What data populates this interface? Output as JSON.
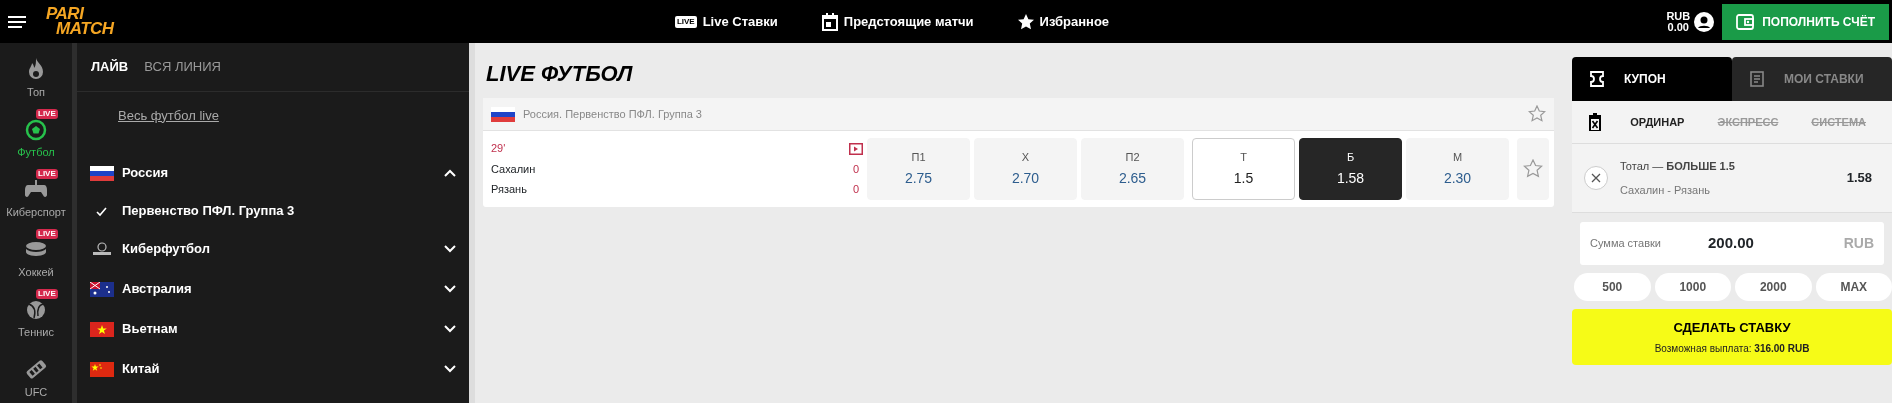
{
  "header": {
    "logo": [
      "PARI",
      "MATCH"
    ],
    "nav": [
      {
        "kind": "live",
        "icon_text": "LIVE",
        "label": "Live Ставки"
      },
      {
        "kind": "calendar",
        "label": "Предстоящие матчи"
      },
      {
        "kind": "star",
        "label": "Избранное"
      }
    ],
    "balance": {
      "currency": "RUB",
      "amount": "0.00"
    },
    "deposit_button": "ПОПОЛНИТЬ СЧЁТ"
  },
  "sports_rail": [
    {
      "kind": "fire",
      "label": "Топ",
      "selected": false
    },
    {
      "kind": "ball",
      "label": "Футбол",
      "badge": "LIVE",
      "selected": true
    },
    {
      "kind": "gamepad",
      "label": "Киберспорт",
      "badge": "LIVE",
      "selected": false
    },
    {
      "kind": "puck",
      "label": "Хоккей",
      "badge": "LIVE",
      "selected": false
    },
    {
      "kind": "tennis",
      "label": "Теннис",
      "badge": "LIVE",
      "selected": false
    },
    {
      "kind": "ufc",
      "label": "UFC",
      "selected": false
    }
  ],
  "tree": {
    "tabs": [
      {
        "label": "ЛАЙВ",
        "selected": true
      },
      {
        "label": "ВСЯ ЛИНИЯ",
        "selected": false
      }
    ],
    "all_link": "Весь футбол live",
    "countries": [
      {
        "kind": "ru",
        "label": "Россия",
        "expanded": true,
        "children": [
          {
            "label": "Первенство ПФЛ. Группа 3",
            "checked": true
          }
        ]
      },
      {
        "kind": "fifa",
        "label": "Киберфутбол",
        "expanded": false
      },
      {
        "kind": "au",
        "label": "Австралия",
        "expanded": false
      },
      {
        "kind": "vn",
        "label": "Вьетнам",
        "expanded": false
      },
      {
        "kind": "cn",
        "label": "Китай",
        "expanded": false
      }
    ]
  },
  "main": {
    "title": "LIVE ФУТБОЛ",
    "league": {
      "kind": "ru",
      "name": "Россия. Первенство ПФЛ. Группа 3"
    },
    "match": {
      "time": "29'",
      "teams": [
        {
          "name": "Сахалин",
          "score": "0"
        },
        {
          "name": "Рязань",
          "score": "0"
        }
      ],
      "odds": [
        {
          "kind": "odd",
          "label": "П1",
          "value": "2.75",
          "selected": false
        },
        {
          "kind": "odd",
          "label": "Х",
          "value": "2.70",
          "selected": false
        },
        {
          "kind": "odd",
          "label": "П2",
          "value": "2.65",
          "selected": false
        },
        {
          "kind": "total",
          "label": "Т",
          "value": "1.5",
          "selected": false
        },
        {
          "kind": "odd",
          "label": "Б",
          "value": "1.58",
          "selected": true
        },
        {
          "kind": "odd",
          "label": "М",
          "value": "2.30",
          "selected": false
        }
      ]
    }
  },
  "coupon": {
    "tabs": [
      {
        "kind": "ticket",
        "label": "КУПОН",
        "selected": true
      },
      {
        "kind": "list",
        "label": "МОИ СТАВКИ",
        "selected": false
      }
    ],
    "bet_types": [
      {
        "label": "ОРДИНАР",
        "disabled": false
      },
      {
        "label": "ЭКСПРЕСС",
        "disabled": true
      },
      {
        "label": "СИСТЕМА",
        "disabled": true
      }
    ],
    "bet": {
      "market": "Тотал — **БОЛЬШЕ 1.5**",
      "match": "Сахалин - Рязань",
      "odd": "1.58"
    },
    "stake": {
      "label": "Сумма ставки",
      "value": "200.00",
      "currency": "RUB"
    },
    "quick_amounts": [
      "500",
      "1000",
      "2000",
      "MAX"
    ],
    "submit": {
      "label": "СДЕЛАТЬ СТАВКУ",
      "payout": "Возможная выплата: **316.00 RUB**"
    }
  }
}
